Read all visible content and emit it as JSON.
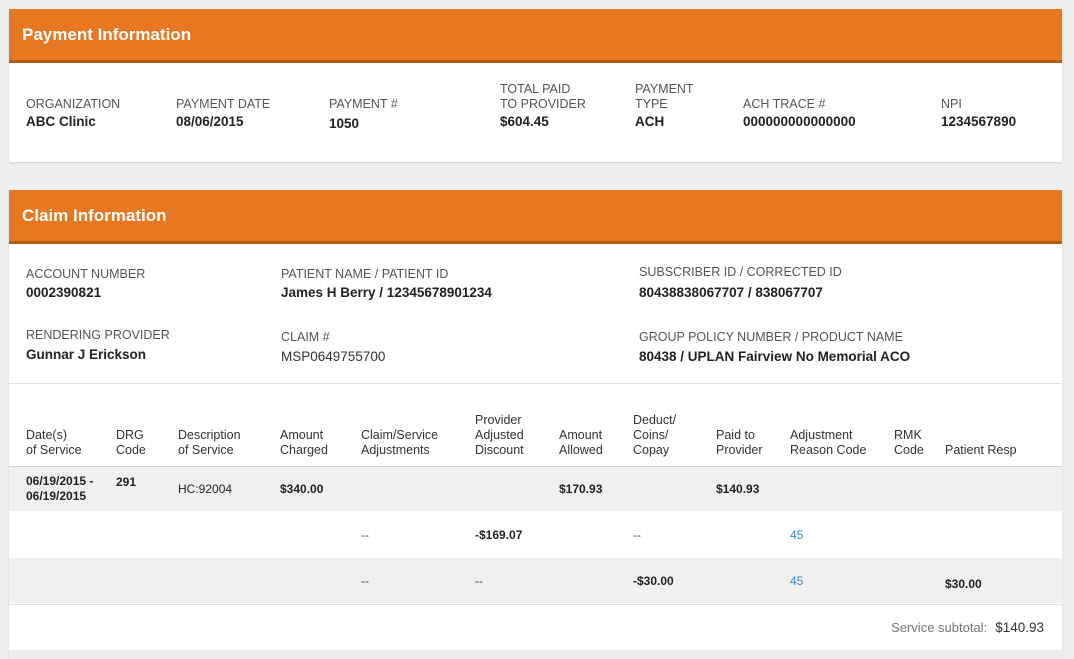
{
  "payment": {
    "title": "Payment Information",
    "fields": {
      "organization_label": "ORGANIZATION",
      "organization_value": "ABC Clinic",
      "payment_date_label": "PAYMENT DATE",
      "payment_date_value": "08/06/2015",
      "payment_number_label": "PAYMENT #",
      "payment_number_value": "1050",
      "total_paid_label_line1": "TOTAL PAID",
      "total_paid_label_line2": "TO PROVIDER",
      "total_paid_value": "$604.45",
      "payment_type_label_line1": "PAYMENT",
      "payment_type_label_line2": "TYPE",
      "payment_type_value": "ACH",
      "ach_trace_label": "ACH TRACE #",
      "ach_trace_value": "000000000000000",
      "npi_label": "NPI",
      "npi_value": "1234567890"
    }
  },
  "claim": {
    "title": "Claim Information",
    "fields": {
      "account_number_label": "ACCOUNT NUMBER",
      "account_number_value": "0002390821",
      "patient_label": "PATIENT NAME / PATIENT ID",
      "patient_value": "James H Berry / 12345678901234",
      "subscriber_label": "SUBSCRIBER ID / CORRECTED ID",
      "subscriber_value": "80438838067707 / 838067707",
      "rendering_provider_label": "RENDERING PROVIDER",
      "rendering_provider_value": "Gunnar J Erickson",
      "claim_number_label": "CLAIM #",
      "claim_number_value": "MSP0649755700",
      "group_policy_label": "GROUP POLICY NUMBER / PRODUCT NAME",
      "group_policy_value": "80438 / UPLAN Fairview No Memorial ACO"
    },
    "table": {
      "headers": {
        "dates_1": "Date(s)",
        "dates_2": "of Service",
        "drg_1": "DRG",
        "drg_2": "Code",
        "desc_1": "Description",
        "desc_2": "of Service",
        "charged_1": "Amount",
        "charged_2": "Charged",
        "adjustments_1": "Claim/Service",
        "adjustments_2": "Adjustments",
        "discount_1": "Provider",
        "discount_2": "Adjusted",
        "discount_3": "Discount",
        "allowed_1": "Amount",
        "allowed_2": "Allowed",
        "deduct_1": "Deduct/",
        "deduct_2": "Coins/",
        "deduct_3": "Copay",
        "paid_1": "Paid to",
        "paid_2": "Provider",
        "reason_1": "Adjustment",
        "reason_2": "Reason Code",
        "rmk_1": "RMK",
        "rmk_2": "Code",
        "patient_resp": "Patient Resp"
      },
      "service_line": {
        "dates_1": "06/19/2015 -",
        "dates_2": "06/19/2015",
        "drg": "291",
        "description": "HC:92004",
        "charged": "$340.00",
        "allowed": "$170.93",
        "paid": "$140.93"
      },
      "adjustments": [
        {
          "claim_service_adj": "--",
          "provider_discount": "-$169.07",
          "deduct_coins_copay": "--",
          "reason_code": "45",
          "patient_resp": ""
        },
        {
          "claim_service_adj": "--",
          "provider_discount": "--",
          "deduct_coins_copay": "-$30.00",
          "reason_code": "45",
          "patient_resp": "$30.00"
        }
      ],
      "subtotal_label": "Service subtotal:",
      "subtotal_value": "$140.93"
    }
  },
  "colors": {
    "header_orange": "#e87722",
    "link_blue": "#3a86c8"
  }
}
